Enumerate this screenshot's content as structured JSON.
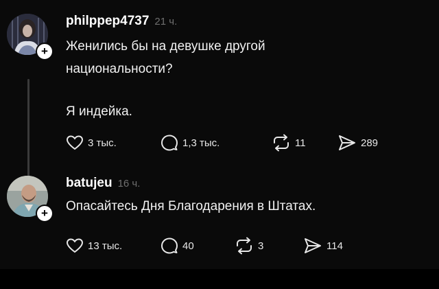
{
  "posts": [
    {
      "username": "philppep4737",
      "time": "21 ч.",
      "text_lines": [
        "Женились бы на девушке другой",
        "национальности?"
      ],
      "reply_text": "Я индейка.",
      "likes": "3 тыс.",
      "comments": "1,3 тыс.",
      "reposts": "11",
      "shares": "289"
    },
    {
      "username": "batujeu",
      "time": "16 ч.",
      "text_lines": [
        "Опасайтесь Дня Благодарения в Штатах."
      ],
      "likes": "13 тыс.",
      "comments": "40",
      "reposts": "3",
      "shares": "114"
    }
  ],
  "badge_symbol": "+",
  "icons": [
    "heart-icon",
    "comment-icon",
    "repost-icon",
    "share-icon"
  ],
  "colors": {
    "background": "#0a0a0a",
    "text": "#f1f1f1",
    "muted": "#6f6f6f",
    "thread_line": "#3a3a3a"
  }
}
